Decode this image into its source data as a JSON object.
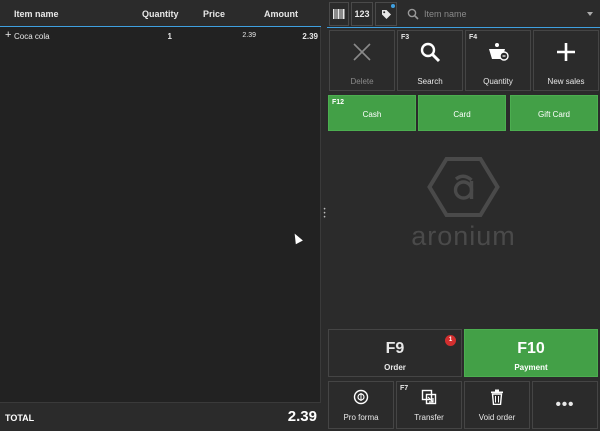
{
  "table": {
    "columns": {
      "name": "Item name",
      "quantity": "Quantity",
      "price": "Price",
      "amount": "Amount"
    },
    "rows": [
      {
        "expander": "+",
        "name": "Coca cola",
        "quantity": "1",
        "price": "2.39",
        "amount": "2.39"
      }
    ]
  },
  "footer": {
    "total_label": "TOTAL",
    "total_value": "2.39"
  },
  "topbar": {
    "barcode_icon": "barcode-icon",
    "numeric_label": "123",
    "tag_icon": "tag-icon",
    "search_placeholder": "Item name"
  },
  "actions": {
    "delete": {
      "label": "Delete",
      "icon": "close-icon"
    },
    "search": {
      "key": "F3",
      "label": "Search",
      "icon": "search-icon"
    },
    "quantity": {
      "key": "F4",
      "label": "Quantity",
      "icon": "scale-icon"
    },
    "new_sales": {
      "label": "New sales",
      "icon": "plus-icon"
    }
  },
  "payment_methods": {
    "cash": {
      "key": "F12",
      "label": "Cash"
    },
    "card": {
      "label": "Card"
    },
    "gift_card": {
      "label": "Gift Card"
    }
  },
  "logo": {
    "text": "aronium",
    "icon": "hexagon-logo-icon"
  },
  "order": {
    "key": "F9",
    "label": "Order",
    "badge": "1"
  },
  "payment": {
    "key": "F10",
    "label": "Payment"
  },
  "bottom": {
    "pro_forma": {
      "label": "Pro forma",
      "icon": "coin-icon"
    },
    "transfer": {
      "key": "F7",
      "label": "Transfer",
      "icon": "transfer-icon"
    },
    "void_order": {
      "label": "Void order",
      "icon": "trash-icon"
    },
    "more": {
      "label": "•••",
      "icon": "more-icon"
    }
  },
  "colors": {
    "accent": "#3fa0e0",
    "green": "#43a047",
    "badge": "#d32f2f",
    "background": "#2b2b2b"
  }
}
